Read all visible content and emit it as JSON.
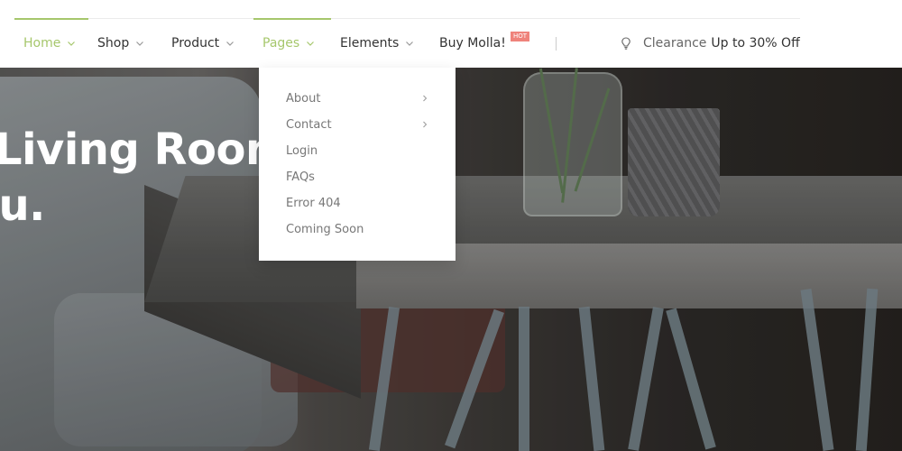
{
  "nav": {
    "items": [
      {
        "label": "Home"
      },
      {
        "label": "Shop"
      },
      {
        "label": "Product"
      },
      {
        "label": "Pages"
      },
      {
        "label": "Elements"
      },
      {
        "label": "Buy Molla!",
        "badge": "HOT"
      }
    ],
    "active_item": "Home",
    "open_item": "Pages"
  },
  "promo": {
    "icon": "lightbulb-icon",
    "muted": "Clearance",
    "strong": "Up to 30% Off"
  },
  "dropdown": {
    "items": [
      {
        "label": "About",
        "has_submenu": true
      },
      {
        "label": "Contact",
        "has_submenu": true
      },
      {
        "label": "Login"
      },
      {
        "label": "FAQs"
      },
      {
        "label": "Error 404"
      },
      {
        "label": "Coming Soon"
      }
    ]
  },
  "hero": {
    "line1": "Living Room",
    "line2": "ou."
  },
  "colors": {
    "accent": "#a6c76c",
    "badge": "#ef837b",
    "text": "#333333",
    "muted": "#777777"
  }
}
